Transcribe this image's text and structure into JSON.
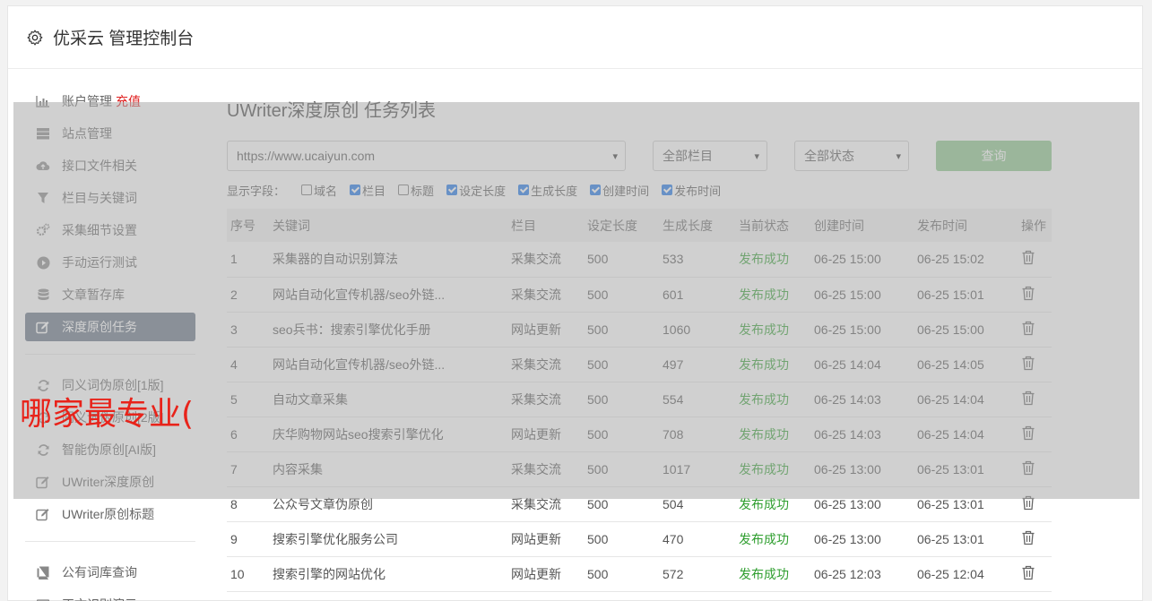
{
  "header": {
    "title": "优采云 管理控制台",
    "icon": "gear-icon"
  },
  "sidebar": {
    "items": [
      {
        "label": "账户管理",
        "extra": "充值",
        "icon": "bar-chart-icon"
      },
      {
        "label": "站点管理",
        "icon": "server-icon"
      },
      {
        "label": "接口文件相关",
        "icon": "cloud-upload-icon"
      },
      {
        "label": "栏目与关键词",
        "icon": "filter-icon"
      },
      {
        "label": "采集细节设置",
        "icon": "cogs-icon"
      },
      {
        "label": "手动运行测试",
        "icon": "play-icon"
      },
      {
        "label": "文章暂存库",
        "icon": "database-icon"
      },
      {
        "label": "深度原创任务",
        "icon": "edit-icon",
        "active": true
      }
    ],
    "items2": [
      {
        "label": "同义词伪原创[1版]",
        "icon": "refresh-icon"
      },
      {
        "label": "同义词伪原创[2版]",
        "icon": "refresh-icon"
      },
      {
        "label": "智能伪原创[AI版]",
        "icon": "refresh-icon"
      },
      {
        "label": "UWriter深度原创",
        "icon": "edit-icon"
      },
      {
        "label": "UWriter原创标题",
        "icon": "edit-icon"
      }
    ],
    "items3": [
      {
        "label": "公有词库查询",
        "icon": "book-icon"
      },
      {
        "label": "正文识别演示",
        "icon": "monitor-icon"
      }
    ]
  },
  "main": {
    "title": "UWriter深度原创 任务列表",
    "site_select": "https://www.ucaiyun.com",
    "column_select": "全部栏目",
    "status_select": "全部状态",
    "query_label": "查询",
    "fields_label": "显示字段：",
    "fields": [
      {
        "label": "域名",
        "checked": false
      },
      {
        "label": "栏目",
        "checked": true
      },
      {
        "label": "标题",
        "checked": false
      },
      {
        "label": "设定长度",
        "checked": true
      },
      {
        "label": "生成长度",
        "checked": true
      },
      {
        "label": "创建时间",
        "checked": true
      },
      {
        "label": "发布时间",
        "checked": true
      }
    ],
    "columns": [
      "序号",
      "关键词",
      "栏目",
      "设定长度",
      "生成长度",
      "当前状态",
      "创建时间",
      "发布时间",
      "操作"
    ],
    "rows": [
      [
        "1",
        "采集器的自动识别算法",
        "采集交流",
        "500",
        "533",
        "发布成功",
        "06-25 15:00",
        "06-25 15:02"
      ],
      [
        "2",
        "网站自动化宣传机器/seo外链...",
        "采集交流",
        "500",
        "601",
        "发布成功",
        "06-25 15:00",
        "06-25 15:01"
      ],
      [
        "3",
        "seo兵书：搜索引擎优化手册",
        "网站更新",
        "500",
        "1060",
        "发布成功",
        "06-25 15:00",
        "06-25 15:00"
      ],
      [
        "4",
        "网站自动化宣传机器/seo外链...",
        "采集交流",
        "500",
        "497",
        "发布成功",
        "06-25 14:04",
        "06-25 14:05"
      ],
      [
        "5",
        "自动文章采集",
        "采集交流",
        "500",
        "554",
        "发布成功",
        "06-25 14:03",
        "06-25 14:04"
      ],
      [
        "6",
        "庆华购物网站seo搜索引擎优化",
        "网站更新",
        "500",
        "708",
        "发布成功",
        "06-25 14:03",
        "06-25 14:04"
      ],
      [
        "7",
        "内容采集",
        "采集交流",
        "500",
        "1017",
        "发布成功",
        "06-25 13:00",
        "06-25 13:01"
      ],
      [
        "8",
        "公众号文章伪原创",
        "采集交流",
        "500",
        "504",
        "发布成功",
        "06-25 13:00",
        "06-25 13:01"
      ],
      [
        "9",
        "搜索引擎优化服务公司",
        "网站更新",
        "500",
        "470",
        "发布成功",
        "06-25 13:00",
        "06-25 13:01"
      ],
      [
        "10",
        "搜索引擎的网站优化",
        "网站更新",
        "500",
        "572",
        "发布成功",
        "06-25 12:03",
        "06-25 12:04"
      ]
    ]
  },
  "watermark": "哪家最专业("
}
